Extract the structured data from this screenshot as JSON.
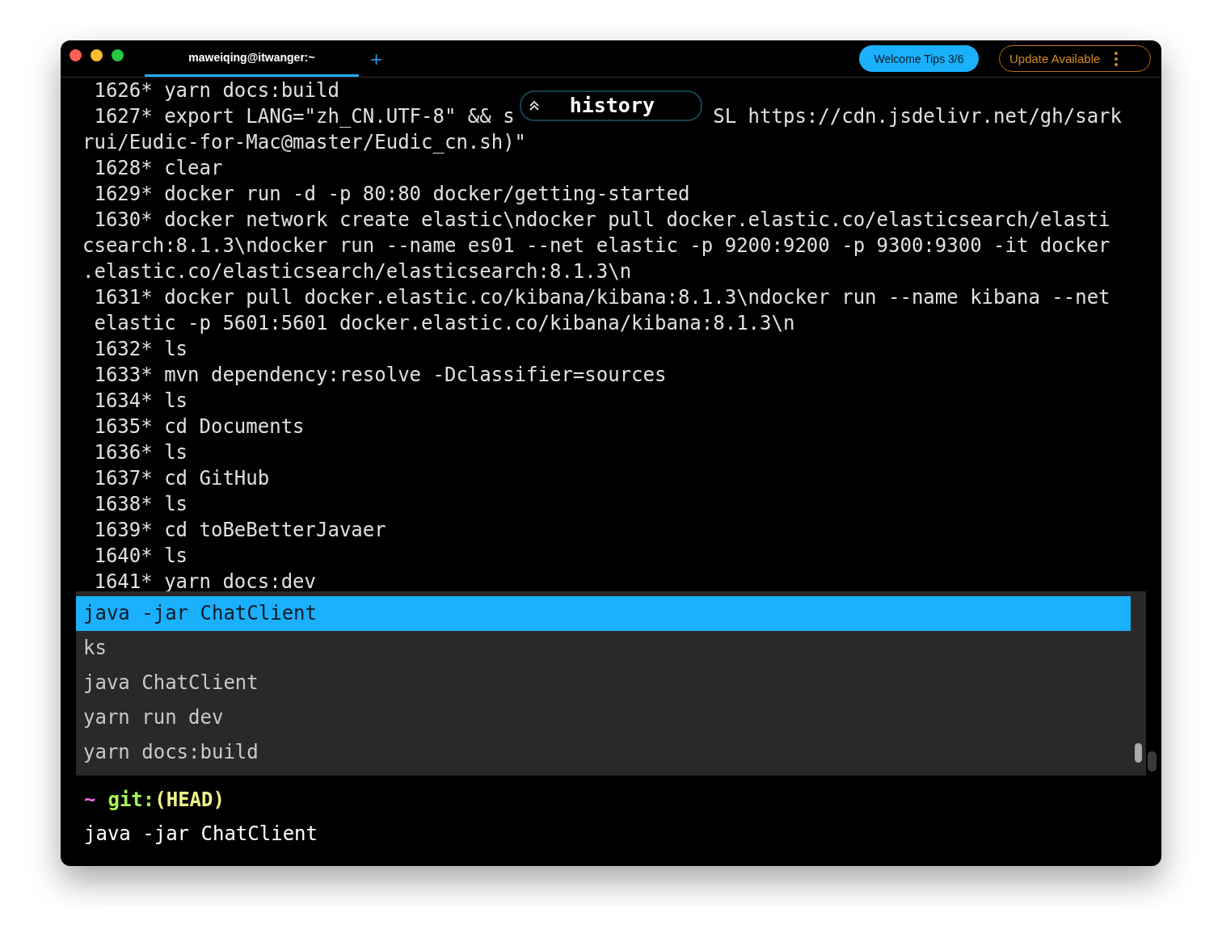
{
  "window": {
    "tabs": [
      {
        "label": "maweiqing@itwanger:~",
        "selected": true
      }
    ],
    "new_tab": "+",
    "buttons": [
      {
        "kind": "filled",
        "label": "Welcome Tips 3/6"
      },
      {
        "kind": "outlined",
        "label": "Update Available"
      }
    ]
  },
  "history_badge": {
    "label": "history"
  },
  "terminal_lines": [
    {
      "text": " 1626* yarn docs:build"
    },
    {
      "text": " 1627* export LANG=\"zh_CN.UTF-8\" && s",
      "text_after": "SL https://cdn.jsdelivr.net/gh/sark"
    },
    {
      "text": "rui/Eudic-for-Mac@master/Eudic_cn.sh)\""
    },
    {
      "text": " 1628* clear"
    },
    {
      "text": " 1629* docker run -d -p 80:80 docker/getting-started"
    },
    {
      "text": " 1630* docker network create elastic\\ndocker pull docker.elastic.co/elasticsearch/elasti"
    },
    {
      "text": "csearch:8.1.3\\ndocker run --name es01 --net elastic -p 9200:9200 -p 9300:9300 -it docker"
    },
    {
      "text": ".elastic.co/elasticsearch/elasticsearch:8.1.3\\n"
    },
    {
      "text": " 1631* docker pull docker.elastic.co/kibana/kibana:8.1.3\\ndocker run --name kibana --net"
    },
    {
      "text": " elastic -p 5601:5601 docker.elastic.co/kibana/kibana:8.1.3\\n"
    },
    {
      "text": " 1632* ls"
    },
    {
      "text": " 1633* mvn dependency:resolve -Dclassifier=sources"
    },
    {
      "text": " 1634* ls"
    },
    {
      "text": " 1635* cd Documents"
    },
    {
      "text": " 1636* ls"
    },
    {
      "text": " 1637* cd GitHub"
    },
    {
      "text": " 1638* ls"
    },
    {
      "text": " 1639* cd toBeBetterJavaer"
    },
    {
      "text": " 1640* ls"
    },
    {
      "text": " 1641* yarn docs:dev"
    }
  ],
  "suggestions": [
    {
      "text": "java -jar ChatClient",
      "selected": true
    },
    {
      "text": "ks",
      "selected": false
    },
    {
      "text": "java ChatClient",
      "selected": false
    },
    {
      "text": "yarn run dev",
      "selected": false
    },
    {
      "text": "yarn docs:build",
      "selected": false
    }
  ],
  "prompt": {
    "dir": "~",
    "git": "git:",
    "branch": "(HEAD)",
    "input": "java -jar ChatClient"
  }
}
